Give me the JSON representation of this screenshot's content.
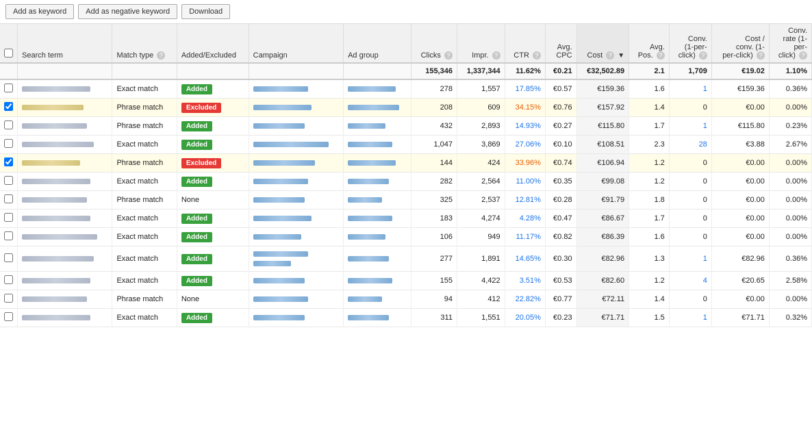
{
  "toolbar": {
    "add_keyword_label": "Add as keyword",
    "add_negative_label": "Add as negative keyword",
    "download_label": "Download"
  },
  "columns": [
    {
      "id": "check",
      "label": "",
      "type": "check"
    },
    {
      "id": "search_term",
      "label": "Search term",
      "type": "text"
    },
    {
      "id": "match_type",
      "label": "Match type",
      "help": true,
      "type": "text"
    },
    {
      "id": "added_excluded",
      "label": "Added/Excluded",
      "type": "text"
    },
    {
      "id": "campaign",
      "label": "Campaign",
      "type": "text"
    },
    {
      "id": "ad_group",
      "label": "Ad group",
      "type": "text"
    },
    {
      "id": "clicks",
      "label": "Clicks",
      "help": true,
      "type": "num"
    },
    {
      "id": "impr",
      "label": "Impr.",
      "help": true,
      "type": "num"
    },
    {
      "id": "ctr",
      "label": "CTR",
      "help": true,
      "type": "num"
    },
    {
      "id": "avg_cpc",
      "label": "Avg. CPC",
      "type": "num"
    },
    {
      "id": "cost",
      "label": "Cost",
      "help": true,
      "sorted": true,
      "type": "num"
    },
    {
      "id": "avg_pos",
      "label": "Avg. Pos.",
      "help": true,
      "type": "num"
    },
    {
      "id": "conv",
      "label": "Conv. (1-per-click)",
      "help": true,
      "type": "num"
    },
    {
      "id": "cost_conv",
      "label": "Cost / conv. (1-per-click)",
      "help": true,
      "type": "num"
    },
    {
      "id": "conv_rate",
      "label": "Conv. rate (1-per-click)",
      "help": true,
      "type": "num"
    }
  ],
  "totals": {
    "clicks": "155,346",
    "impr": "1,337,344",
    "ctr": "11.62%",
    "avg_cpc": "€0.21",
    "cost": "€32,502.89",
    "avg_pos": "2.1",
    "conv": "1,709",
    "cost_conv": "€19.02",
    "conv_rate": "1.10%"
  },
  "rows": [
    {
      "checked": false,
      "highlighted": false,
      "search_term_width": 100,
      "match_type": "Exact match",
      "status": "Added",
      "campaign_width": 80,
      "campaign_blue": true,
      "ad_group_width": 70,
      "ad_group_blue": true,
      "clicks": "278",
      "impr": "1,557",
      "ctr": "17.85%",
      "avg_cpc": "€0.57",
      "cost": "€159.36",
      "avg_pos": "1.6",
      "conv": "1",
      "cost_conv": "€159.36",
      "conv_rate": "0.36%"
    },
    {
      "checked": true,
      "highlighted": true,
      "search_term_width": 90,
      "match_type": "Phrase match",
      "status": "Excluded",
      "campaign_width": 85,
      "campaign_blue": true,
      "ad_group_width": 75,
      "ad_group_blue": true,
      "clicks": "208",
      "impr": "609",
      "ctr": "34.15%",
      "avg_cpc": "€0.76",
      "cost": "€157.92",
      "avg_pos": "1.4",
      "conv": "0",
      "cost_conv": "€0.00",
      "conv_rate": "0.00%"
    },
    {
      "checked": false,
      "highlighted": false,
      "search_term_width": 95,
      "match_type": "Phrase match",
      "status": "Added",
      "campaign_width": 75,
      "campaign_blue": true,
      "ad_group_width": 55,
      "ad_group_blue": true,
      "clicks": "432",
      "impr": "2,893",
      "ctr": "14.93%",
      "avg_cpc": "€0.27",
      "cost": "€115.80",
      "avg_pos": "1.7",
      "conv": "1",
      "cost_conv": "€115.80",
      "conv_rate": "0.23%"
    },
    {
      "checked": false,
      "highlighted": false,
      "search_term_width": 105,
      "match_type": "Exact match",
      "status": "Added",
      "campaign_width": 110,
      "campaign_blue": true,
      "ad_group_width": 65,
      "ad_group_blue": true,
      "clicks": "1,047",
      "impr": "3,869",
      "ctr": "27.06%",
      "avg_cpc": "€0.10",
      "cost": "€108.51",
      "avg_pos": "2.3",
      "conv": "28",
      "cost_conv": "€3.88",
      "conv_rate": "2.67%"
    },
    {
      "checked": true,
      "highlighted": true,
      "search_term_width": 85,
      "match_type": "Phrase match",
      "status": "Excluded",
      "campaign_width": 90,
      "campaign_blue": true,
      "ad_group_width": 70,
      "ad_group_blue": true,
      "clicks": "144",
      "impr": "424",
      "ctr": "33.96%",
      "avg_cpc": "€0.74",
      "cost": "€106.94",
      "avg_pos": "1.2",
      "conv": "0",
      "cost_conv": "€0.00",
      "conv_rate": "0.00%"
    },
    {
      "checked": false,
      "highlighted": false,
      "search_term_width": 100,
      "match_type": "Exact match",
      "status": "Added",
      "campaign_width": 80,
      "campaign_blue": true,
      "ad_group_width": 60,
      "ad_group_blue": true,
      "clicks": "282",
      "impr": "2,564",
      "ctr": "11.00%",
      "avg_cpc": "€0.35",
      "cost": "€99.08",
      "avg_pos": "1.2",
      "conv": "0",
      "cost_conv": "€0.00",
      "conv_rate": "0.00%"
    },
    {
      "checked": false,
      "highlighted": false,
      "search_term_width": 95,
      "match_type": "Phrase match",
      "status": "None",
      "campaign_width": 75,
      "campaign_blue": true,
      "ad_group_width": 50,
      "ad_group_blue": true,
      "clicks": "325",
      "impr": "2,537",
      "ctr": "12.81%",
      "avg_cpc": "€0.28",
      "cost": "€91.79",
      "avg_pos": "1.8",
      "conv": "0",
      "cost_conv": "€0.00",
      "conv_rate": "0.00%"
    },
    {
      "checked": false,
      "highlighted": false,
      "search_term_width": 100,
      "match_type": "Exact match",
      "status": "Added",
      "campaign_width": 85,
      "campaign_blue": true,
      "ad_group_width": 65,
      "ad_group_blue": true,
      "clicks": "183",
      "impr": "4,274",
      "ctr": "4.28%",
      "avg_cpc": "€0.47",
      "cost": "€86.67",
      "avg_pos": "1.7",
      "conv": "0",
      "cost_conv": "€0.00",
      "conv_rate": "0.00%"
    },
    {
      "checked": false,
      "highlighted": false,
      "search_term_width": 110,
      "match_type": "Exact match",
      "status": "Added",
      "campaign_width": 70,
      "campaign_blue": true,
      "ad_group_width": 55,
      "ad_group_blue": true,
      "clicks": "106",
      "impr": "949",
      "ctr": "11.17%",
      "avg_cpc": "€0.82",
      "cost": "€86.39",
      "avg_pos": "1.6",
      "conv": "0",
      "cost_conv": "€0.00",
      "conv_rate": "0.00%"
    },
    {
      "checked": false,
      "highlighted": false,
      "search_term_width": 105,
      "match_type": "Exact match",
      "status": "Added",
      "campaign_width": 80,
      "campaign_blue": true,
      "ad_group_width": 60,
      "ad_group_blue": true,
      "clicks": "277",
      "impr": "1,891",
      "ctr": "14.65%",
      "avg_cpc": "€0.30",
      "cost": "€82.96",
      "avg_pos": "1.3",
      "conv": "1",
      "cost_conv": "€82.96",
      "conv_rate": "0.36%"
    },
    {
      "checked": false,
      "highlighted": false,
      "search_term_width": 100,
      "match_type": "Exact match",
      "status": "Added",
      "campaign_width": 75,
      "campaign_blue": true,
      "ad_group_width": 65,
      "ad_group_blue": true,
      "clicks": "155",
      "impr": "4,422",
      "ctr": "3.51%",
      "avg_cpc": "€0.53",
      "cost": "€82.60",
      "avg_pos": "1.2",
      "conv": "4",
      "cost_conv": "€20.65",
      "conv_rate": "2.58%"
    },
    {
      "checked": false,
      "highlighted": false,
      "search_term_width": 95,
      "match_type": "Phrase match",
      "status": "None",
      "campaign_width": 80,
      "campaign_blue": true,
      "ad_group_width": 50,
      "ad_group_blue": true,
      "clicks": "94",
      "impr": "412",
      "ctr": "22.82%",
      "avg_cpc": "€0.77",
      "cost": "€72.11",
      "avg_pos": "1.4",
      "conv": "0",
      "cost_conv": "€0.00",
      "conv_rate": "0.00%"
    },
    {
      "checked": false,
      "highlighted": false,
      "search_term_width": 100,
      "match_type": "Exact match",
      "status": "Added",
      "campaign_width": 75,
      "campaign_blue": true,
      "ad_group_width": 60,
      "ad_group_blue": true,
      "clicks": "311",
      "impr": "1,551",
      "ctr": "20.05%",
      "avg_cpc": "€0.23",
      "cost": "€71.71",
      "avg_pos": "1.5",
      "conv": "1",
      "cost_conv": "€71.71",
      "conv_rate": "0.32%"
    }
  ]
}
